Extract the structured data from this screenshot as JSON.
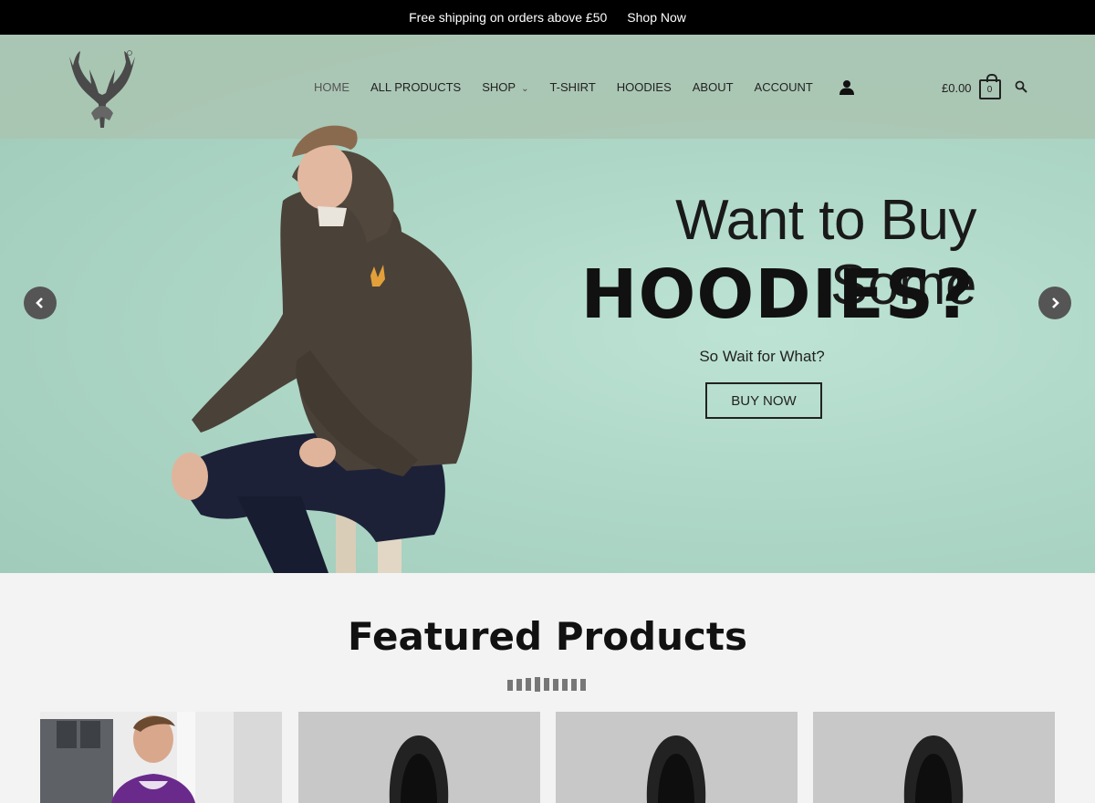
{
  "topbar": {
    "message": "Free shipping on orders above £50",
    "link": "Shop Now"
  },
  "nav": {
    "items": [
      {
        "label": "HOME"
      },
      {
        "label": "ALL PRODUCTS"
      },
      {
        "label": "SHOP"
      },
      {
        "label": "T-SHIRT"
      },
      {
        "label": "HOODIES"
      },
      {
        "label": "ABOUT"
      },
      {
        "label": "ACCOUNT"
      }
    ],
    "user_icon": "user-icon"
  },
  "cart": {
    "total": "£0.00",
    "count": "0",
    "search_icon": "search-icon"
  },
  "hero": {
    "headline_line1": "Want to Buy Some",
    "headline_line2": "HOODIES?",
    "tagline": "So Wait for What?",
    "button": "BUY NOW",
    "prev_icon": "chevron-left-icon",
    "next_icon": "chevron-right-icon"
  },
  "featured": {
    "title": "Featured Products"
  },
  "colors": {
    "topbar": "#000000",
    "hero_bg": "#add6c6",
    "header_overlay": "#aac4b2",
    "arrow": "#555555"
  }
}
